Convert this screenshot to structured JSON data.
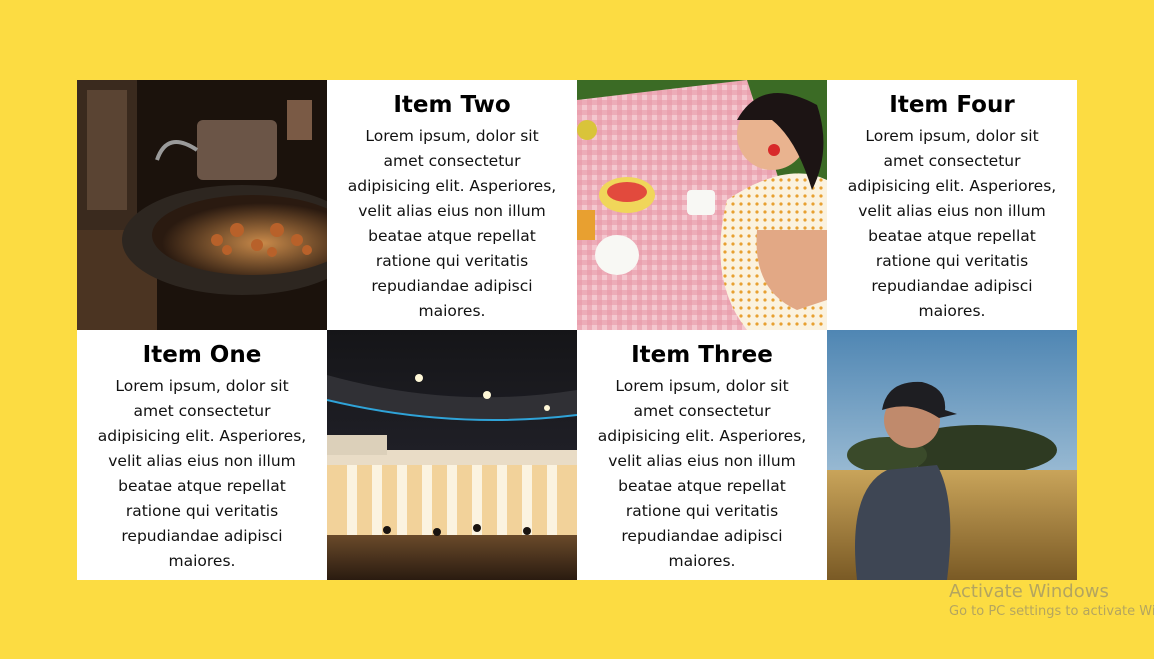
{
  "items": [
    {
      "title": "Item One",
      "body": "Lorem ipsum, dolor sit amet consectetur adipisicing elit. Asperiores, velit alias eius non illum beatae atque repellat ratione qui veritatis repudiandae adipisci maiores."
    },
    {
      "title": "Item Two",
      "body": "Lorem ipsum, dolor sit amet consectetur adipisicing elit. Asperiores, velit alias eius non illum beatae atque repellat ratione qui veritatis repudiandae adipisci maiores."
    },
    {
      "title": "Item Three",
      "body": "Lorem ipsum, dolor sit amet consectetur adipisicing elit. Asperiores, velit alias eius non illum beatae atque repellat ratione qui veritatis repudiandae adipisci maiores."
    },
    {
      "title": "Item Four",
      "body": "Lorem ipsum, dolor sit amet consectetur adipisicing elit. Asperiores, velit alias eius non illum beatae atque repellat ratione qui veritatis repudiandae adipisci maiores."
    }
  ],
  "watermark": {
    "title": "Activate Windows",
    "subtitle": "Go to PC settings to activate Windows."
  },
  "colors": {
    "background": "#fcdc42",
    "card": "#ffffff"
  }
}
